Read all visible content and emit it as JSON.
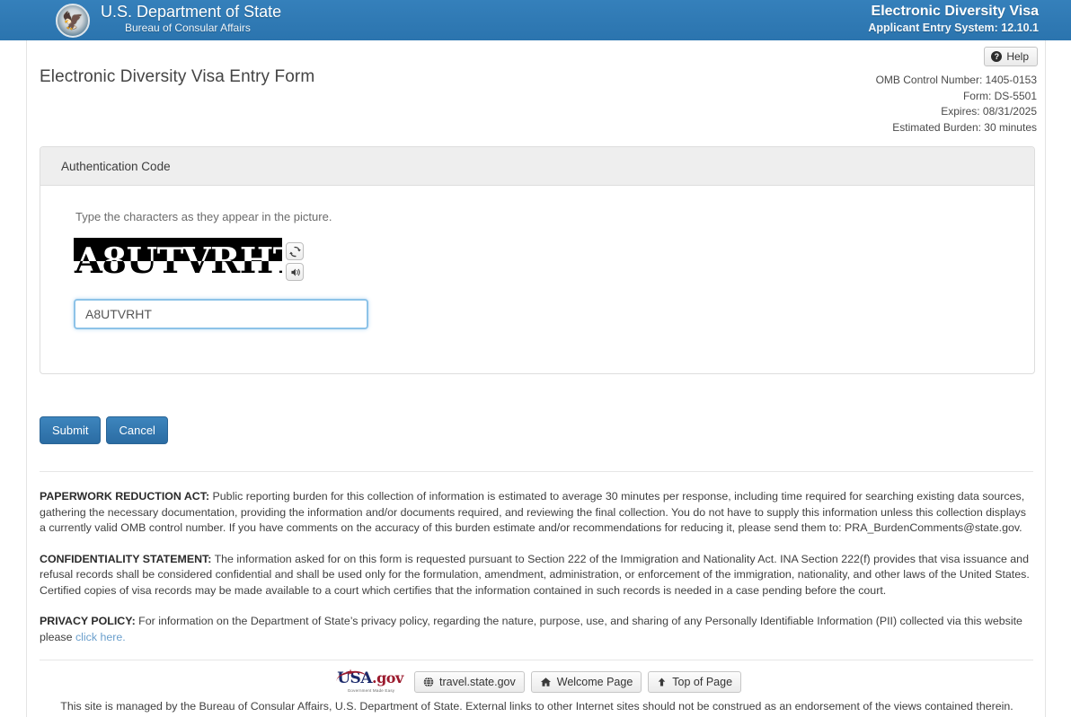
{
  "banner": {
    "seal_icon": "department-of-state-seal",
    "agency_title": "U.S. Department of State",
    "agency_sub": "Bureau of Consular Affairs",
    "system_title": "Electronic Diversity Visa",
    "system_sub": "Applicant Entry System: 12.10.1",
    "background_color": "#2e79b5"
  },
  "header": {
    "help_label": "Help",
    "help_icon": "question-circle-icon",
    "page_title": "Electronic Diversity Visa Entry Form",
    "omb": [
      "OMB Control Number: 1405-0153",
      "Form: DS-5501",
      "Expires: 08/31/2025",
      "Estimated Burden: 30 minutes"
    ]
  },
  "panel": {
    "heading": "Authentication Code",
    "instruction": "Type the characters as they appear in the picture.",
    "captcha_text": "A8UTVRHT",
    "refresh_icon": "refresh-icon",
    "audio_icon": "audio-speaker-icon",
    "input_value": "A8UTVRHT",
    "input_placeholder": ""
  },
  "actions": {
    "submit_label": "Submit",
    "cancel_label": "Cancel",
    "primary_color": "#2b6ca3"
  },
  "legal": {
    "paperwork_heading": "PAPERWORK REDUCTION ACT:",
    "paperwork_body": " Public reporting burden for this collection of information is estimated to average 30 minutes per response, including time required for searching existing data sources, gathering the necessary documentation, providing the information and/or documents required, and reviewing the final collection. You do not have to supply this information unless this collection displays a currently valid OMB control number. If you have comments on the accuracy of this burden estimate and/or recommendations for reducing it, please send them to: PRA_BurdenComments@state.gov.",
    "confidentiality_heading": "CONFIDENTIALITY STATEMENT:",
    "confidentiality_body": " The information asked for on this form is requested pursuant to Section 222 of the Immigration and Nationality Act. INA Section 222(f) provides that visa issuance and refusal records shall be considered confidential and shall be used only for the formulation, amendment, administration, or enforcement of the immigration, nationality, and other laws of the United States. Certified copies of visa records may be made available to a court which certifies that the information contained in such records is needed in a case pending before the court.",
    "privacy_heading": "PRIVACY POLICY:",
    "privacy_body": " For information on the Department of State’s privacy policy, regarding the nature, purpose, use, and sharing of any Personally Identifiable Information (PII) collected via this website please ",
    "privacy_link": "click here.",
    "link_color": "#6a9fcc"
  },
  "footer": {
    "usagov_usa": "USA",
    "usagov_gov": ".gov",
    "usagov_tagline": "Government Made Easy",
    "links": [
      {
        "icon": "globe-icon",
        "label": "travel.state.gov"
      },
      {
        "icon": "home-icon",
        "label": "Welcome Page"
      },
      {
        "icon": "arrow-up-icon",
        "label": "Top of Page"
      }
    ],
    "managed_by": "This site is managed by the Bureau of Consular Affairs, U.S. Department of State. External links to other Internet sites should not be construed as an endorsement of the views contained therein."
  }
}
